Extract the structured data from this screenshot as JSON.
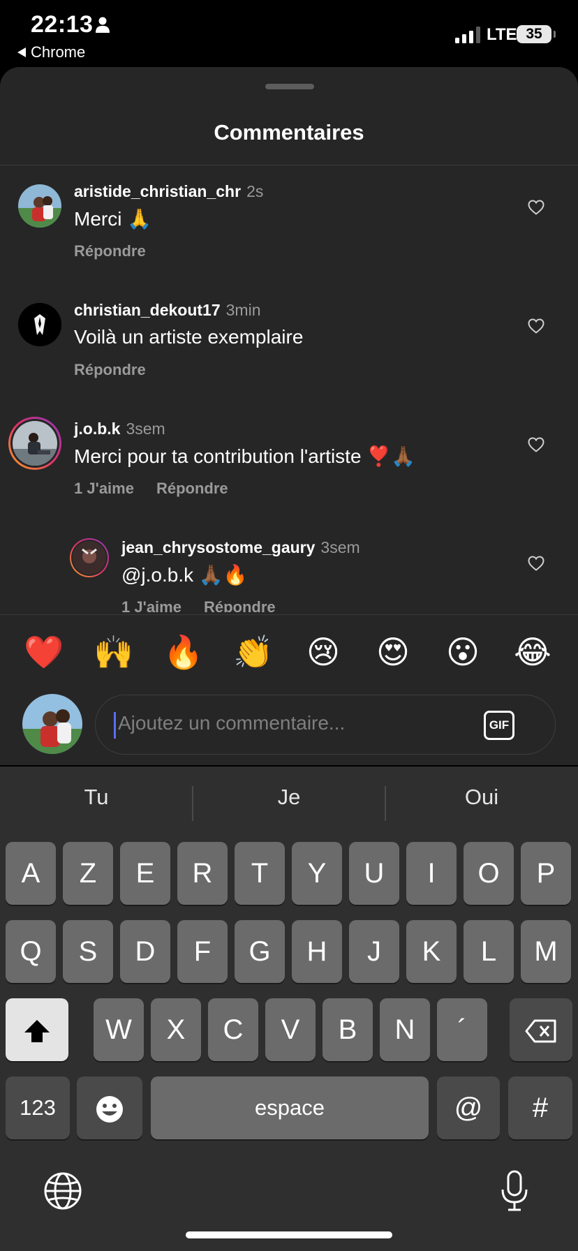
{
  "status_bar": {
    "time": "22:13",
    "back_app": "Chrome",
    "network": "LTE",
    "battery": "35"
  },
  "sheet": {
    "title": "Commentaires"
  },
  "comments": [
    {
      "username": "aristide_christian_chr",
      "time": "2s",
      "text": "Merci 🙏",
      "likes": "",
      "reply": "Répondre"
    },
    {
      "username": "christian_dekout17",
      "time": "3min",
      "text": "Voilà un artiste exemplaire",
      "likes": "",
      "reply": "Répondre"
    },
    {
      "username": "j.o.b.k",
      "time": "3sem",
      "text": "Merci pour ta contribution l'artiste ❣️🙏🏾",
      "likes": "1 J'aime",
      "reply": "Répondre"
    },
    {
      "username": "jean_chrysostome_gaury",
      "time": "3sem",
      "text": "@j.o.b.k 🙏🏾🔥",
      "likes": "1 J'aime",
      "reply": "Répondre"
    }
  ],
  "quick_emojis": [
    "❤️",
    "🙌",
    "🔥",
    "👏",
    "😢",
    "😍",
    "😮",
    "😂"
  ],
  "composer": {
    "placeholder": "Ajoutez un commentaire...",
    "gif_label": "GIF"
  },
  "keyboard": {
    "suggestions": [
      "Tu",
      "Je",
      "Oui"
    ],
    "row1": [
      "A",
      "Z",
      "E",
      "R",
      "T",
      "Y",
      "U",
      "I",
      "O",
      "P"
    ],
    "row2": [
      "Q",
      "S",
      "D",
      "F",
      "G",
      "H",
      "J",
      "K",
      "L",
      "M"
    ],
    "row3": [
      "W",
      "X",
      "C",
      "V",
      "B",
      "N",
      "´"
    ],
    "numbers_key": "123",
    "space_key": "espace",
    "at_key": "@",
    "hash_key": "#"
  }
}
